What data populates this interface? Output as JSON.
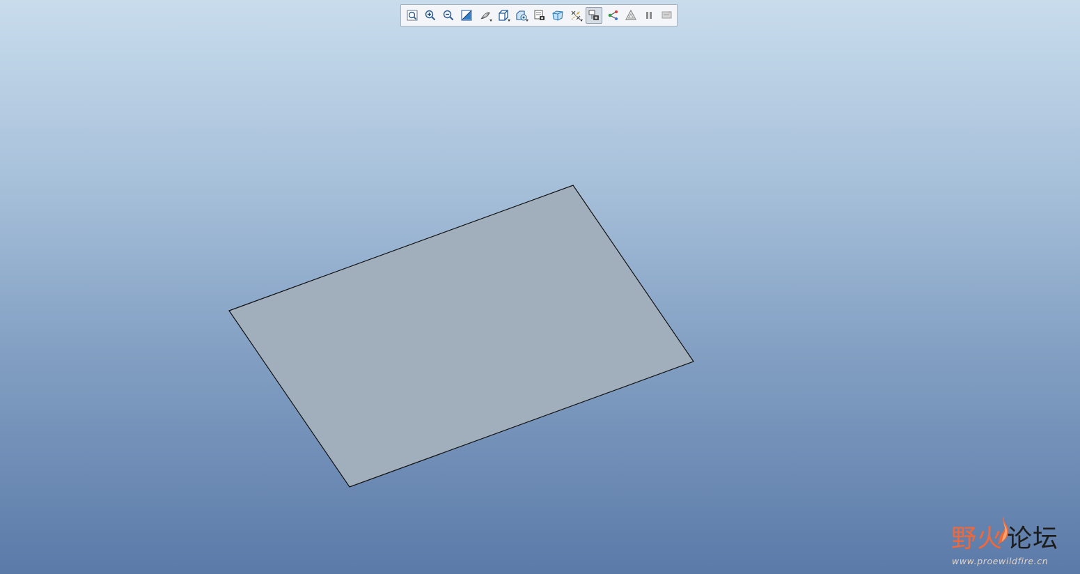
{
  "viewport": {
    "background_top": "#c8dcec",
    "background_bottom": "#5b7aa8"
  },
  "toolbar": {
    "buttons": [
      {
        "icon": "refit-icon",
        "active": false,
        "dropdown": false
      },
      {
        "icon": "zoom-in-icon",
        "active": false,
        "dropdown": false
      },
      {
        "icon": "zoom-out-icon",
        "active": false,
        "dropdown": false
      },
      {
        "icon": "repaint-icon",
        "active": false,
        "dropdown": false
      },
      {
        "icon": "display-style-icon",
        "active": false,
        "dropdown": true
      },
      {
        "icon": "saved-orientations-icon",
        "active": false,
        "dropdown": true
      },
      {
        "icon": "view-manager-icon",
        "active": false,
        "dropdown": true
      },
      {
        "icon": "layers-icon",
        "active": false,
        "dropdown": false
      },
      {
        "icon": "perspective-view-icon",
        "active": false,
        "dropdown": false
      },
      {
        "icon": "datum-display-icon",
        "active": false,
        "dropdown": true
      },
      {
        "icon": "annotation-display-icon",
        "active": true,
        "dropdown": false
      },
      {
        "icon": "spin-center-icon",
        "active": false,
        "dropdown": false
      },
      {
        "icon": "simulation-display-icon",
        "active": false,
        "dropdown": false
      },
      {
        "icon": "pause-icon",
        "active": false,
        "dropdown": false
      },
      {
        "icon": "regenerate-icon",
        "active": false,
        "dropdown": false
      }
    ]
  },
  "model": {
    "type": "planar-surface",
    "fill_color": "#a1aebc",
    "edge_color": "#111111"
  },
  "watermark": {
    "part1": "野火",
    "part2": "论坛",
    "url": "www.proewildfire.cn",
    "accent_color": "#f0683a"
  }
}
